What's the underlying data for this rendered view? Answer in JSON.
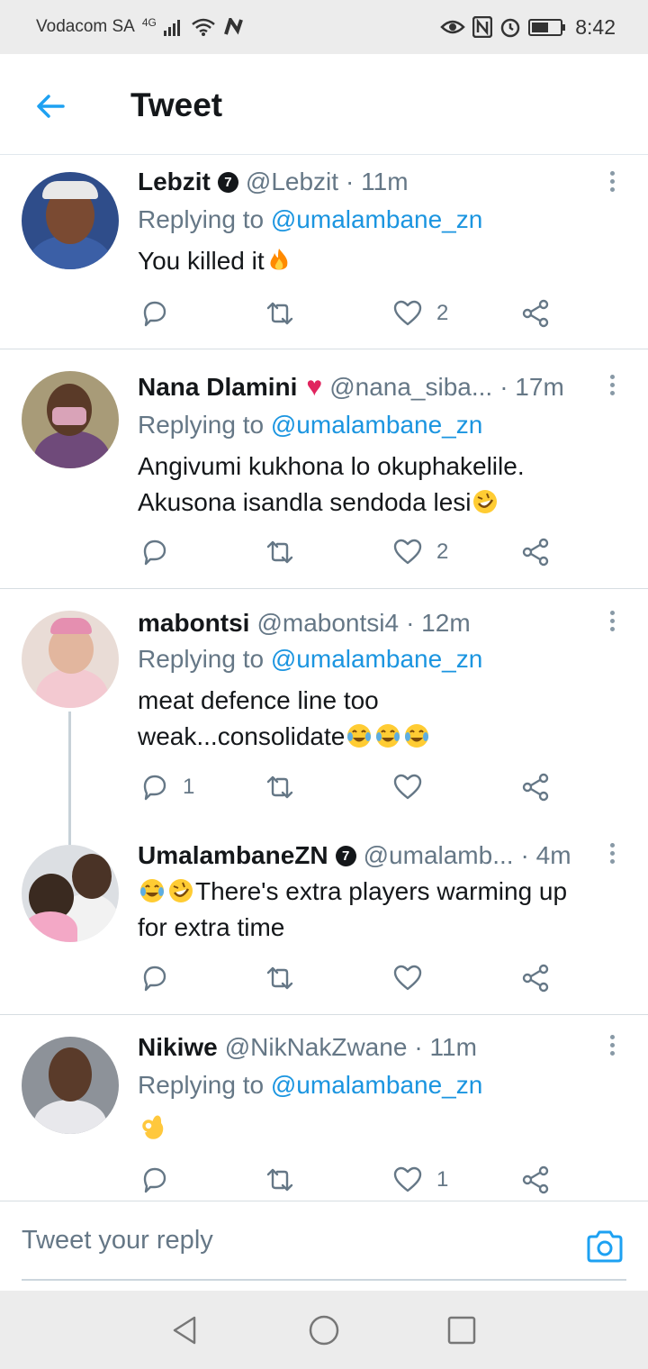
{
  "status_bar": {
    "carrier": "Vodacom SA",
    "network": "4G",
    "time": "8:42"
  },
  "header": {
    "title": "Tweet",
    "back_icon": "arrow-left-icon"
  },
  "colors": {
    "accent": "#1da1f2",
    "mention": "#1b95e0",
    "secondary_text": "#657786",
    "heart_red": "#e0245e"
  },
  "tweets": [
    {
      "name": "Lebzit",
      "verified_badge": "7",
      "handle": "@Lebzit",
      "time": "· 11m",
      "replying_label": "Replying to",
      "replying_to": "@umalambane_zn",
      "text": "You killed it",
      "emojis": [
        "fire"
      ],
      "likes": "2",
      "replies": ""
    },
    {
      "name": "Nana Dlamini",
      "badge_emoji": "red-heart",
      "handle": "@nana_siba...",
      "time": "· 17m",
      "replying_label": "Replying to",
      "replying_to": "@umalambane_zn",
      "text_line1": "Angivumi kukhona lo okuphakelile.",
      "text_line2": "Akusona isandla sendoda lesi",
      "emojis": [
        "rolling-on-floor-laughing"
      ],
      "likes": "2",
      "replies": ""
    },
    {
      "name": "mabontsi",
      "handle": "@mabontsi4",
      "time": "· 12m",
      "replying_label": "Replying to",
      "replying_to": "@umalambane_zn",
      "text_line1": "meat defence line too",
      "text_line2": "weak...consolidate",
      "emojis": [
        "tears-of-joy",
        "tears-of-joy",
        "tears-of-joy"
      ],
      "likes": "",
      "replies": "1"
    },
    {
      "name": "UmalambaneZN",
      "verified_badge": "7",
      "handle": "@umalamb...",
      "time": "· 4m",
      "text_line1": "There's extra players warming up",
      "text_line2": "for extra time",
      "emojis": [
        "tears-of-joy",
        "rolling-on-floor-laughing"
      ],
      "likes": "",
      "replies": ""
    },
    {
      "name": "Nikiwe",
      "handle": "@NikNakZwane",
      "time": "· 11m",
      "replying_label": "Replying to",
      "replying_to": "@umalambane_zn",
      "emojis": [
        "ok-hand"
      ],
      "likes": "1",
      "replies": ""
    }
  ],
  "composer": {
    "placeholder": "Tweet your reply",
    "camera_icon": "camera-icon"
  },
  "nav_bar": {
    "back": "triangle-back-icon",
    "home": "circle-home-icon",
    "recents": "square-recents-icon"
  }
}
